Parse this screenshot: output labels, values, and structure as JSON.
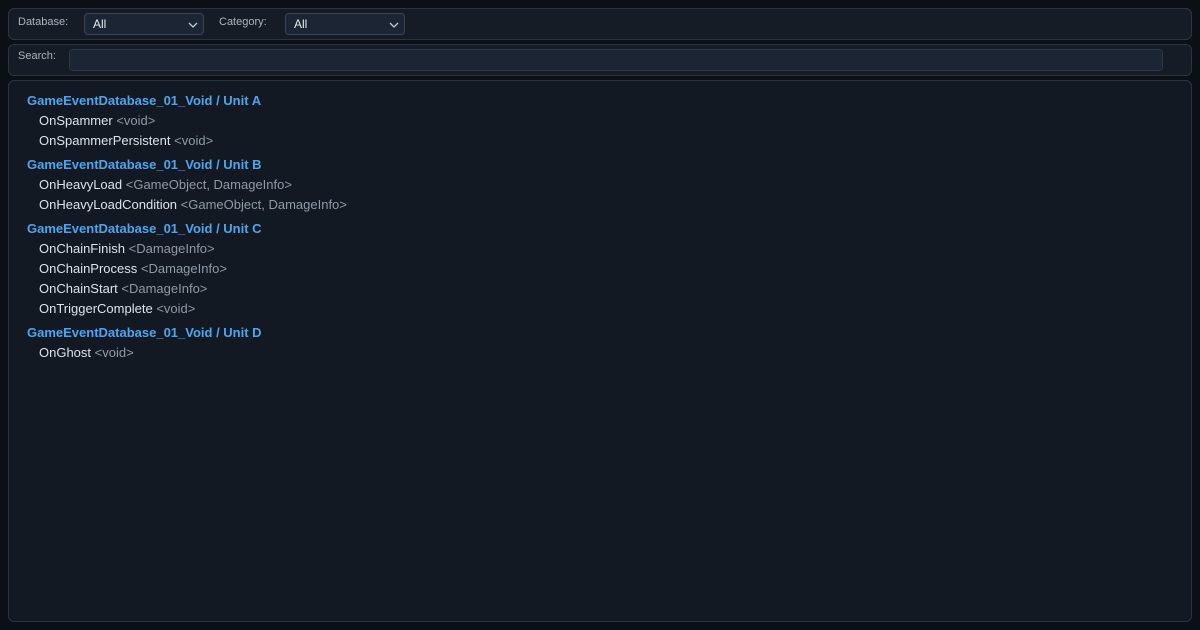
{
  "filters": {
    "database_label": "Database:",
    "database_value": "All",
    "category_label": "Category:",
    "category_value": "All"
  },
  "search": {
    "label": "Search:",
    "value": ""
  },
  "groups": [
    {
      "title": "GameEventDatabase_01_Void / Unit A",
      "events": [
        {
          "name": "OnSpammer",
          "type": "<void>"
        },
        {
          "name": "OnSpammerPersistent",
          "type": "<void>"
        }
      ]
    },
    {
      "title": "GameEventDatabase_01_Void / Unit B",
      "events": [
        {
          "name": "OnHeavyLoad",
          "type": "<GameObject, DamageInfo>"
        },
        {
          "name": "OnHeavyLoadCondition",
          "type": "<GameObject, DamageInfo>"
        }
      ]
    },
    {
      "title": "GameEventDatabase_01_Void / Unit C",
      "events": [
        {
          "name": "OnChainFinish",
          "type": "<DamageInfo>"
        },
        {
          "name": "OnChainProcess",
          "type": "<DamageInfo>"
        },
        {
          "name": "OnChainStart",
          "type": "<DamageInfo>"
        },
        {
          "name": "OnTriggerComplete",
          "type": "<void>"
        }
      ]
    },
    {
      "title": "GameEventDatabase_01_Void / Unit D",
      "events": [
        {
          "name": "OnGhost",
          "type": "<void>"
        }
      ]
    }
  ],
  "colors": {
    "group_header": "#4aa6f0",
    "event_name": "#dde3ea",
    "event_type": "#8f9aa7",
    "background": "#0b1016"
  },
  "icons": {
    "dropdown": "chevron-down-icon"
  }
}
